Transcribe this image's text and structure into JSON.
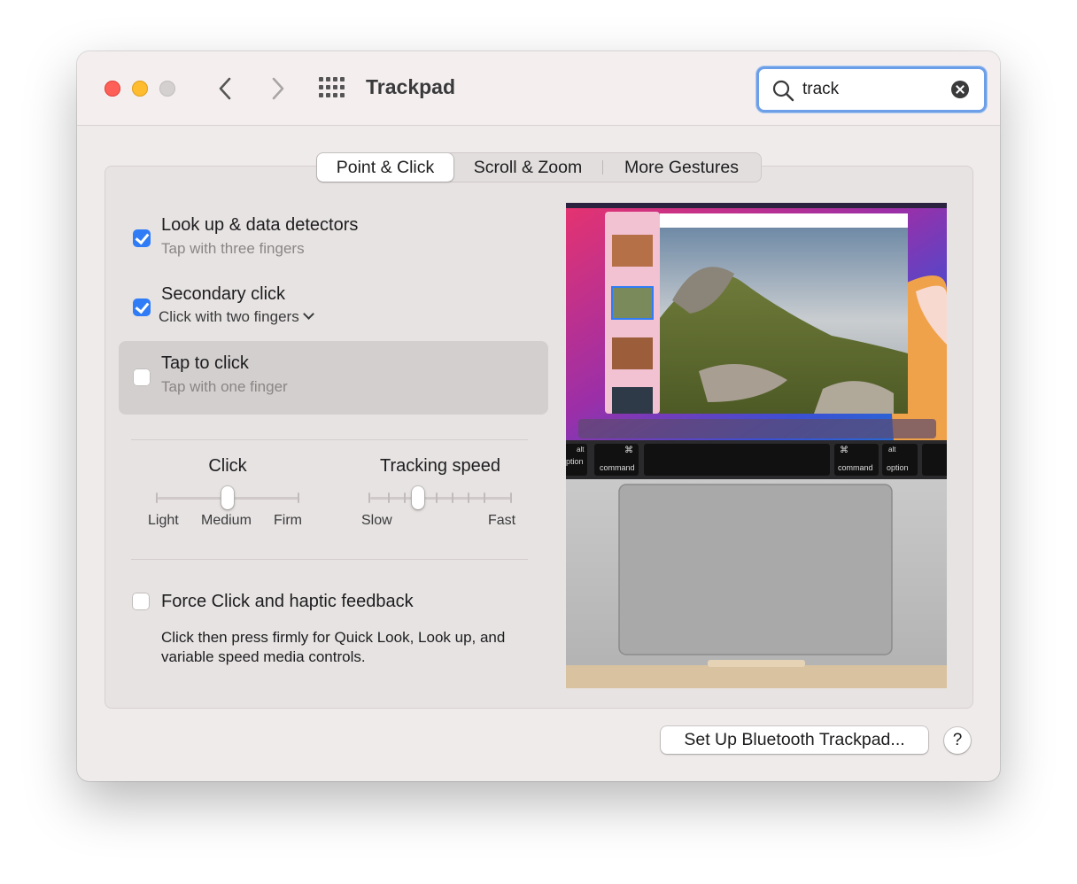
{
  "window": {
    "title": "Trackpad"
  },
  "search": {
    "value": "track"
  },
  "tabs": [
    {
      "label": "Point & Click",
      "selected": true
    },
    {
      "label": "Scroll & Zoom",
      "selected": false
    },
    {
      "label": "More Gestures",
      "selected": false
    }
  ],
  "options": {
    "lookup": {
      "title": "Look up & data detectors",
      "subtitle": "Tap with three fingers",
      "checked": true
    },
    "secondary": {
      "title": "Secondary click",
      "subtitle": "Click with two fingers",
      "checked": true
    },
    "tap": {
      "title": "Tap to click",
      "subtitle": "Tap with one finger",
      "checked": false
    },
    "force": {
      "title": "Force Click and haptic feedback",
      "description": "Click then press firmly for Quick Look, Look up, and variable speed media controls.",
      "checked": false
    }
  },
  "sliders": {
    "click": {
      "title": "Click",
      "labels": [
        "Light",
        "Medium",
        "Firm"
      ],
      "value": 0.5
    },
    "tracking": {
      "title": "Tracking speed",
      "min_label": "Slow",
      "max_label": "Fast",
      "value": 0.36
    }
  },
  "preview": {
    "keys": {
      "alt": "alt",
      "command": "command",
      "cmd_symbol": "⌘",
      "option": "option",
      "option_partial": "ption"
    }
  },
  "buttons": {
    "setup": "Set Up Bluetooth Trackpad...",
    "help": "?"
  },
  "colors": {
    "accent": "#2f7cf6",
    "focus_ring": "#6d9fe8",
    "close": "#fe5f57",
    "minimize": "#febc2e"
  }
}
